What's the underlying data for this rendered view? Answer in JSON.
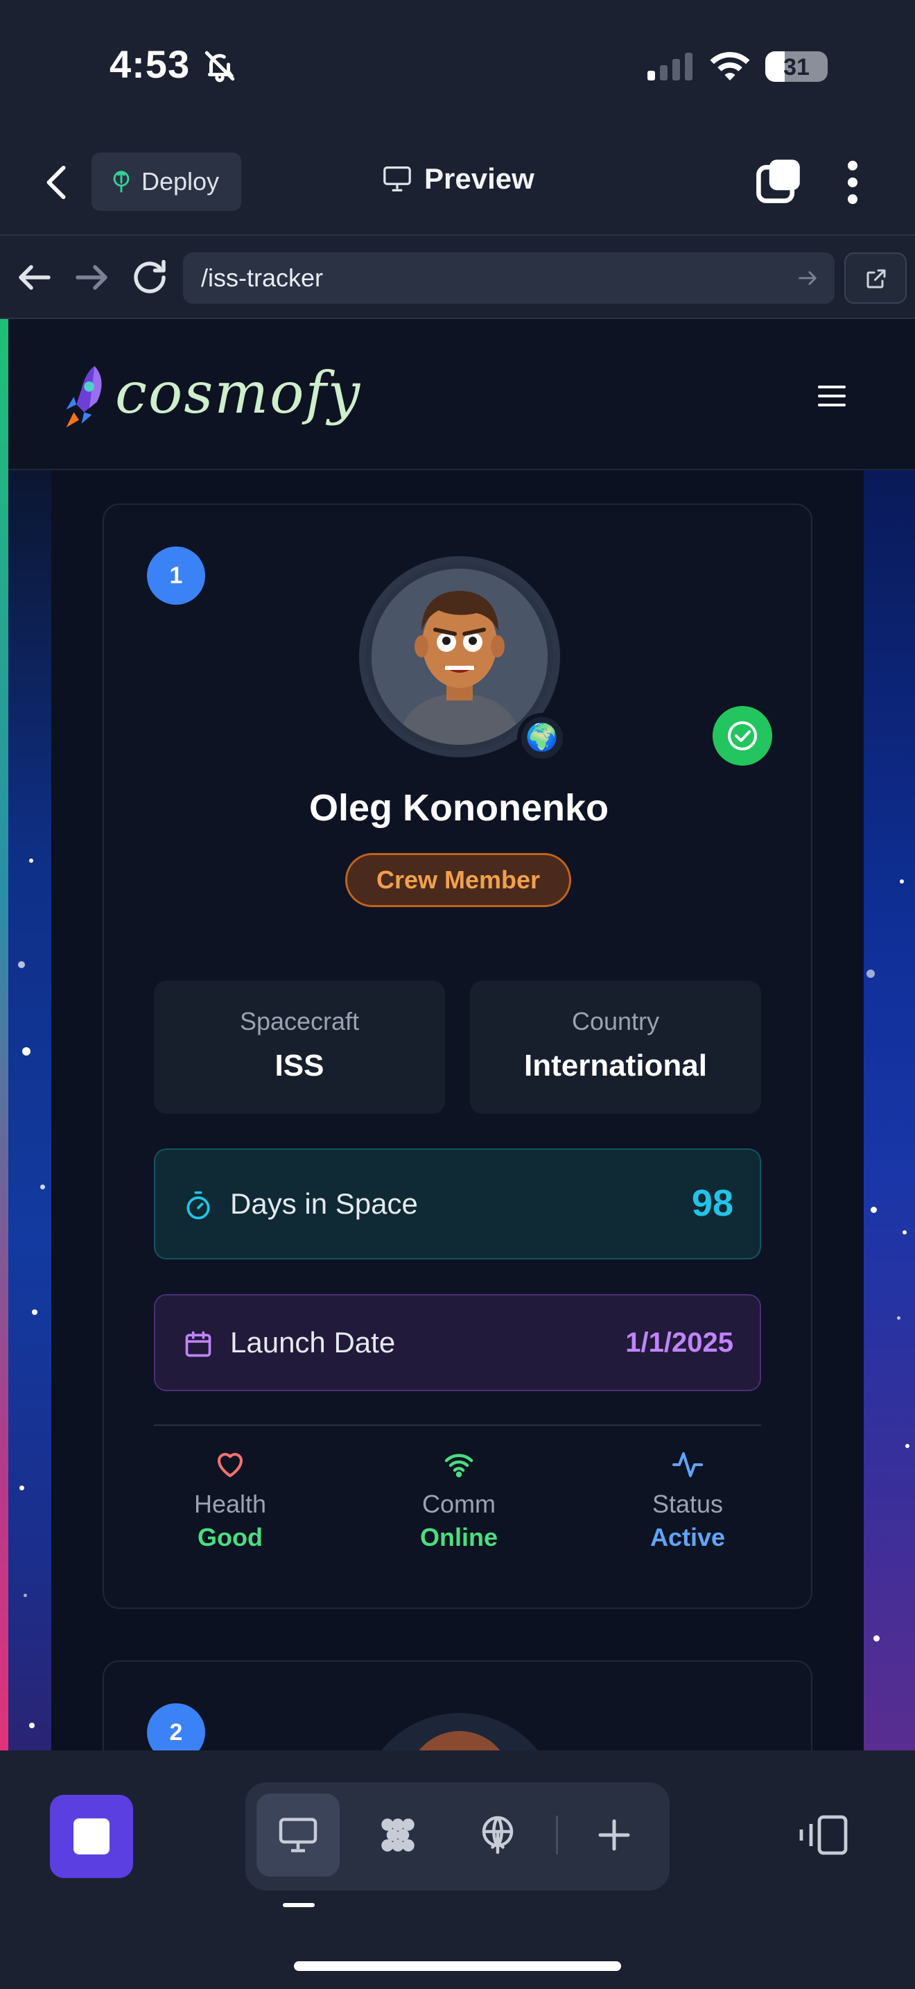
{
  "status_bar": {
    "time": "4:53",
    "battery": "31",
    "battery_level": 0.31
  },
  "toolbar": {
    "deploy_label": "Deploy",
    "preview_label": "Preview"
  },
  "url_bar": {
    "path": "/iss-tracker"
  },
  "site": {
    "logo_text": "cosmofy"
  },
  "crew": [
    {
      "index": "1",
      "name": "Oleg Kononenko",
      "role": "Crew Member",
      "spacecraft_label": "Spacecraft",
      "spacecraft": "ISS",
      "country_label": "Country",
      "country": "International",
      "days_label": "Days in Space",
      "days": "98",
      "launch_label": "Launch Date",
      "launch_date": "1/1/2025",
      "vitals": [
        {
          "label": "Health",
          "value": "Good",
          "color": "#4ade80",
          "icon": "heart-icon"
        },
        {
          "label": "Comm",
          "value": "Online",
          "color": "#4ade80",
          "icon": "wifi-icon"
        },
        {
          "label": "Status",
          "value": "Active",
          "color": "#60a5fa",
          "icon": "activity-icon"
        }
      ]
    },
    {
      "index": "2"
    }
  ],
  "colors": {
    "accent_blue": "#3b82f6",
    "role_orange": "#f2a04c",
    "days_cyan": "#22c5e8",
    "launch_purple": "#c084fc",
    "success_green": "#22c55e",
    "stop_purple": "#5b3fe0"
  }
}
